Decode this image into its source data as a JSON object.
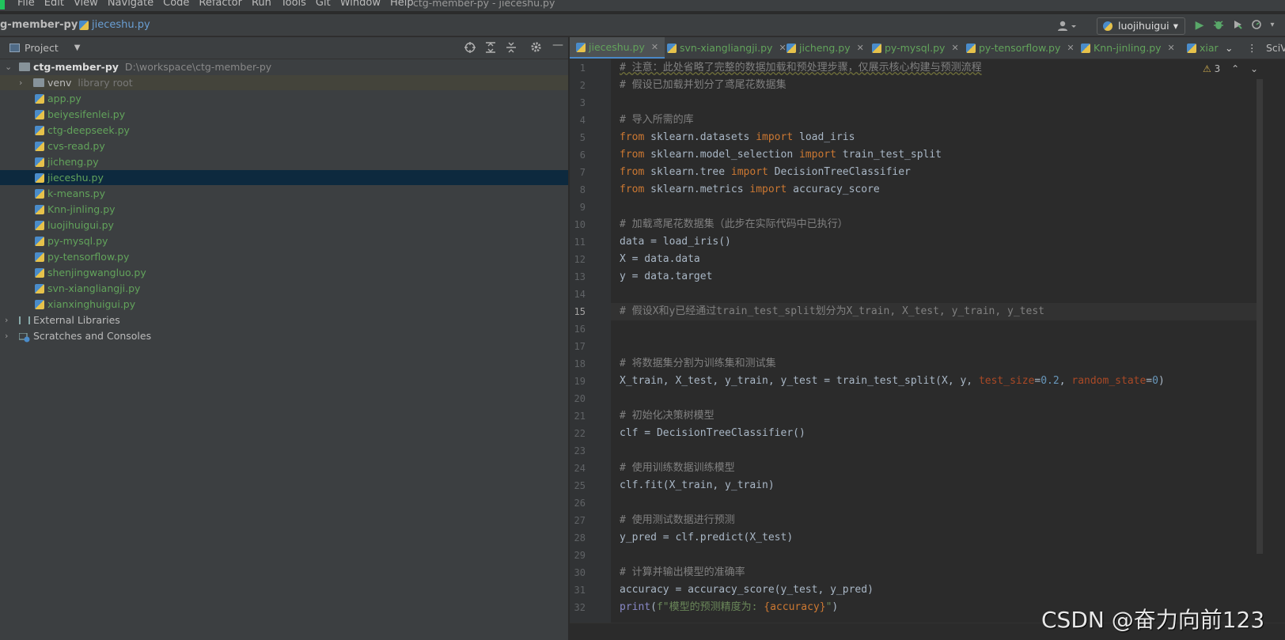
{
  "window_title": "ctg-member-py - jieceshu.py",
  "menu": [
    "File",
    "Edit",
    "View",
    "Navigate",
    "Code",
    "Refactor",
    "Run",
    "Tools",
    "Git",
    "Window",
    "Help"
  ],
  "breadcrumb": {
    "project": "g-member-py",
    "file": "jieceshu.py"
  },
  "run_config": "luojihuigui",
  "project_panel": {
    "title": "Project",
    "root_name": "ctg-member-py",
    "root_path": "D:\\workspace\\ctg-member-py",
    "venv": "venv",
    "venv_note": "library root",
    "files": [
      "app.py",
      "beiyesifenlei.py",
      "ctg-deepseek.py",
      "cvs-read.py",
      "jicheng.py",
      "jieceshu.py",
      "k-means.py",
      "Knn-jinling.py",
      "luojihuigui.py",
      "py-mysql.py",
      "py-tensorflow.py",
      "shenjingwangluo.py",
      "svn-xiangliangji.py",
      "xianxinghuigui.py"
    ],
    "selected_file": "jieceshu.py",
    "external": "External Libraries",
    "scratches": "Scratches and Consoles"
  },
  "tabs": [
    "jieceshu.py",
    "svn-xiangliangji.py",
    "jicheng.py",
    "py-mysql.py",
    "py-tensorflow.py",
    "Knn-jinling.py",
    "xiar"
  ],
  "right_edge": "SciV",
  "inspection_count": "3",
  "code": {
    "l1": "# 注意：此处省略了完整的数据加载和预处理步骤，仅展示核心构建与预测流程",
    "l2": "# 假设已加载并划分了鸢尾花数据集",
    "l4": "# 导入所需的库",
    "l5a": "from",
    "l5b": " sklearn.datasets ",
    "l5c": "import",
    "l5d": " load_iris",
    "l6b": " sklearn.model_selection ",
    "l6d": " train_test_split",
    "l7b": " sklearn.tree ",
    "l7d": " DecisionTreeClassifier",
    "l8b": " sklearn.metrics ",
    "l8d": " accuracy_score",
    "l10": "# 加载鸢尾花数据集（此步在实际代码中已执行）",
    "l11": "data = load_iris()",
    "l12": "X = data.data",
    "l13": "y = data.target",
    "l15": "# 假设X和y已经通过train_test_split划分为X_train, X_test, y_train, y_test",
    "l18": "# 将数据集分割为训练集和测试集",
    "l19a": "X_train, X_test, y_train, y_test = train_test_split(X, y, ",
    "l19b": "test_size",
    "l19c": "=",
    "l19d": "0.2",
    "l19e": ", ",
    "l19f": "random_state",
    "l19g": "=",
    "l19h": "0",
    "l19i": ")",
    "l21": "# 初始化决策树模型",
    "l22": "clf = DecisionTreeClassifier()",
    "l24": "# 使用训练数据训练模型",
    "l25": "clf.fit(X_train, y_train)",
    "l27": "# 使用测试数据进行预测",
    "l28": "y_pred = clf.predict(X_test)",
    "l30": "# 计算并输出模型的准确率",
    "l31": "accuracy = accuracy_score(y_test, y_pred)",
    "l32a": "print",
    "l32b": "(",
    "l32c": "f\"模型的预测精度为: ",
    "l32d": "{accuracy}",
    "l32e": "\"",
    "l32f": ")"
  },
  "line_numbers": [
    "1",
    "2",
    "3",
    "4",
    "5",
    "6",
    "7",
    "8",
    "9",
    "10",
    "11",
    "12",
    "13",
    "14",
    "15",
    "16",
    "17",
    "18",
    "19",
    "20",
    "21",
    "22",
    "23",
    "24",
    "25",
    "26",
    "27",
    "28",
    "29",
    "30",
    "31",
    "32"
  ],
  "watermark": "CSDN @奋力向前123",
  "colors": {
    "keyword": "#cc7832",
    "comment": "#808080",
    "param": "#aa4926",
    "number": "#6897bb",
    "string": "#6a8759",
    "file_green": "#62a35b",
    "selection": "#0d293e"
  }
}
